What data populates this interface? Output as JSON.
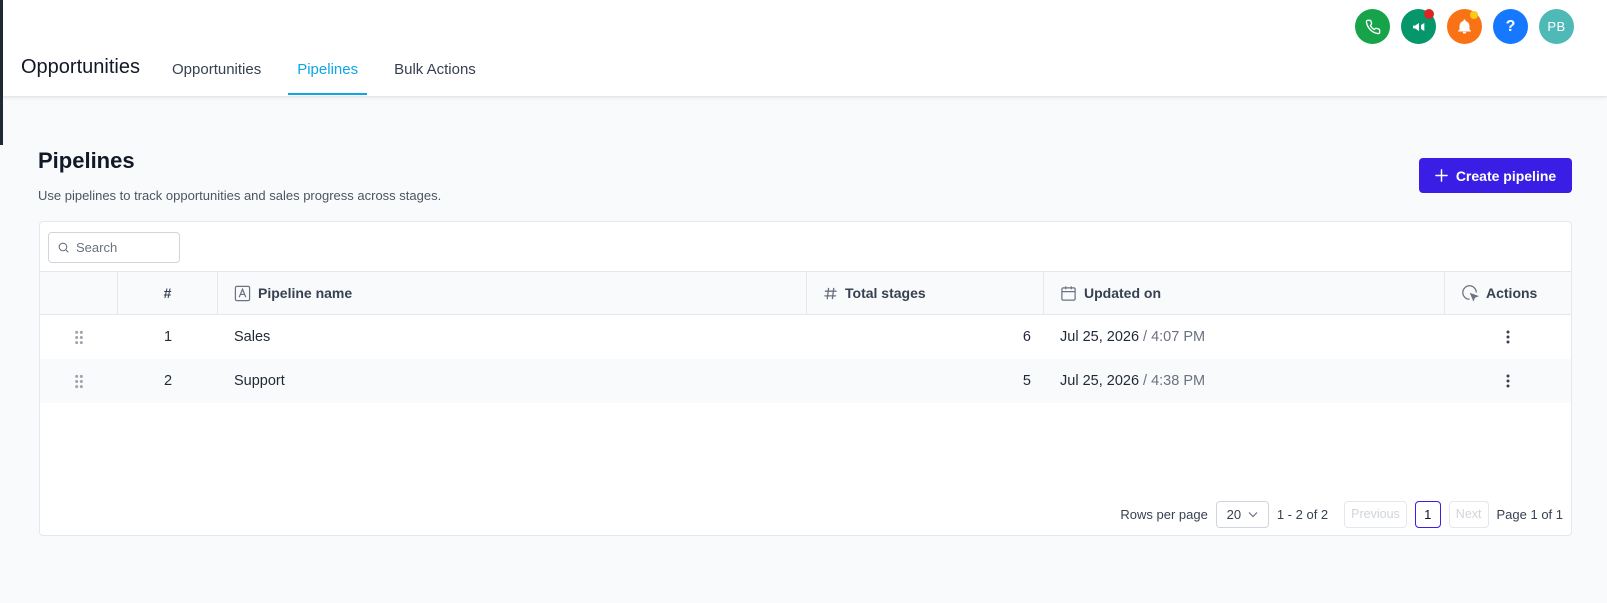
{
  "header": {
    "app_title": "Opportunities",
    "tabs": [
      {
        "label": "Opportunities",
        "active": false
      },
      {
        "label": "Pipelines",
        "active": true
      },
      {
        "label": "Bulk Actions",
        "active": false
      }
    ],
    "icons": [
      {
        "name": "phone-icon",
        "color": "#16a34a"
      },
      {
        "name": "megaphone-icon",
        "color": "#059669",
        "badge_color": "#dc2626"
      },
      {
        "name": "bell-icon",
        "color": "#f97316",
        "badge_color": "#facc15"
      },
      {
        "name": "help-icon",
        "color": "#1677ff"
      }
    ],
    "avatar": {
      "initials": "PB",
      "color": "#4fb9b7"
    }
  },
  "page": {
    "title": "Pipelines",
    "subtitle": "Use pipelines to track opportunities and sales progress across stages.",
    "create_button_label": "Create pipeline",
    "accent_color": "#3b1ee6"
  },
  "search": {
    "placeholder": "Search",
    "value": ""
  },
  "table": {
    "columns": {
      "number": "#",
      "name": "Pipeline name",
      "stages": "Total stages",
      "updated": "Updated on",
      "actions": "Actions"
    },
    "rows": [
      {
        "number": "1",
        "name": "Sales",
        "stages": "6",
        "date": "Jul 25, 2026",
        "time": "/ 4:07 PM"
      },
      {
        "number": "2",
        "name": "Support",
        "stages": "5",
        "date": "Jul 25, 2026",
        "time": "/ 4:38 PM"
      }
    ]
  },
  "pagination": {
    "rows_per_page_label": "Rows per page",
    "rows_per_page_value": "20",
    "range": "1 - 2 of 2",
    "previous_label": "Previous",
    "current_page": "1",
    "next_label": "Next",
    "page_of": "Page 1 of 1"
  }
}
